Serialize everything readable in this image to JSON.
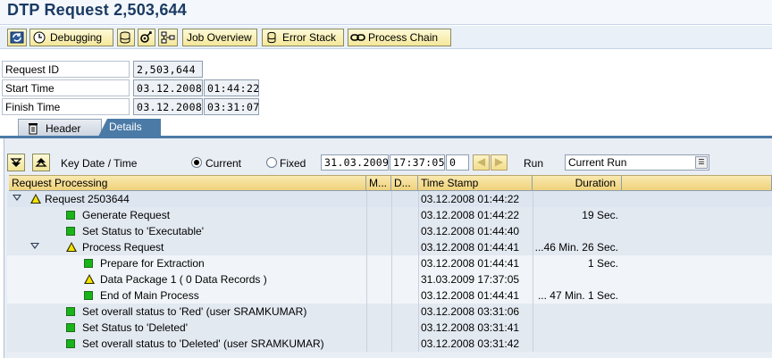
{
  "page": {
    "title": "DTP Request 2,503,644"
  },
  "toolbar": {
    "debugging_label": "Debugging",
    "job_overview_label": "Job Overview",
    "error_stack_label": "Error Stack",
    "process_chain_label": "Process Chain"
  },
  "fields": {
    "request_id": {
      "label": "Request ID",
      "value": "2,503,644"
    },
    "start_time": {
      "label": "Start Time",
      "date": "03.12.2008",
      "time": "01:44:22"
    },
    "finish_time": {
      "label": "Finish Time",
      "date": "03.12.2008",
      "time": "03:31:07"
    }
  },
  "tabs": {
    "header": "Header",
    "details": "Details"
  },
  "controls": {
    "key_date_label": "Key Date / Time",
    "current_label": "Current",
    "fixed_label": "Fixed",
    "date": "31.03.2009",
    "time": "17:37:05",
    "counter": "0",
    "run_label": "Run",
    "run_value": "Current Run"
  },
  "grid": {
    "columns": {
      "request_processing": "Request Processing",
      "m": "M...",
      "d": "D...",
      "time_stamp": "Time Stamp",
      "duration": "Duration"
    },
    "rows": [
      {
        "level": 0,
        "icon": "warning",
        "expand": true,
        "label": "Request 2503644",
        "time": "03.12.2008 01:44:22",
        "duration": ""
      },
      {
        "level": 1,
        "icon": "green",
        "expand": false,
        "label": "Generate Request",
        "time": "03.12.2008 01:44:22",
        "duration": "19 Sec."
      },
      {
        "level": 1,
        "icon": "green",
        "expand": false,
        "label": "Set Status to 'Executable'",
        "time": "03.12.2008 01:44:40",
        "duration": ""
      },
      {
        "level": 1,
        "icon": "warning",
        "expand": true,
        "label": "Process Request",
        "time": "03.12.2008 01:44:41",
        "duration": "...46 Min. 26 Sec."
      },
      {
        "level": 2,
        "icon": "green",
        "expand": false,
        "label": "Prepare for Extraction",
        "time": "03.12.2008 01:44:41",
        "duration": "1 Sec."
      },
      {
        "level": 2,
        "icon": "warning",
        "expand": false,
        "label": "Data Package 1 ( 0 Data Records )",
        "time": "31.03.2009 17:37:05",
        "duration": ""
      },
      {
        "level": 2,
        "icon": "green",
        "expand": false,
        "label": "End of Main Process",
        "time": "03.12.2008 01:44:41",
        "duration": "... 47 Min. 1 Sec."
      },
      {
        "level": 1,
        "icon": "green",
        "expand": false,
        "label": "Set overall status to 'Red' (user SRAMKUMAR)",
        "time": "03.12.2008 03:31:06",
        "duration": ""
      },
      {
        "level": 1,
        "icon": "green",
        "expand": false,
        "label": "Set Status to 'Deleted'",
        "time": "03.12.2008 03:31:41",
        "duration": ""
      },
      {
        "level": 1,
        "icon": "green",
        "expand": false,
        "label": "Set overall status to 'Deleted' (user SRAMKUMAR)",
        "time": "03.12.2008 03:31:42",
        "duration": ""
      }
    ]
  },
  "icons": {
    "refresh": "refresh-icon",
    "debugging": "debug-clock-icon",
    "database": "database-icon",
    "settings": "gear-tools-icon",
    "hierarchy": "hierarchy-icon",
    "job_overview": "job-overview-icon",
    "error_stack": "error-stack-icon",
    "process_chain": "process-chain-icon",
    "header_tab": "trash-icon",
    "expand_all": "expand-all-icon",
    "collapse_all": "collapse-all-icon",
    "status_green": "green-square-icon",
    "status_warning": "yellow-triangle-icon"
  },
  "colors": {
    "accent": "#4b7aa6",
    "title": "#1b3a63",
    "button": "#f5e89a",
    "status_green": "#18b418",
    "status_warning": "#f4e200"
  }
}
